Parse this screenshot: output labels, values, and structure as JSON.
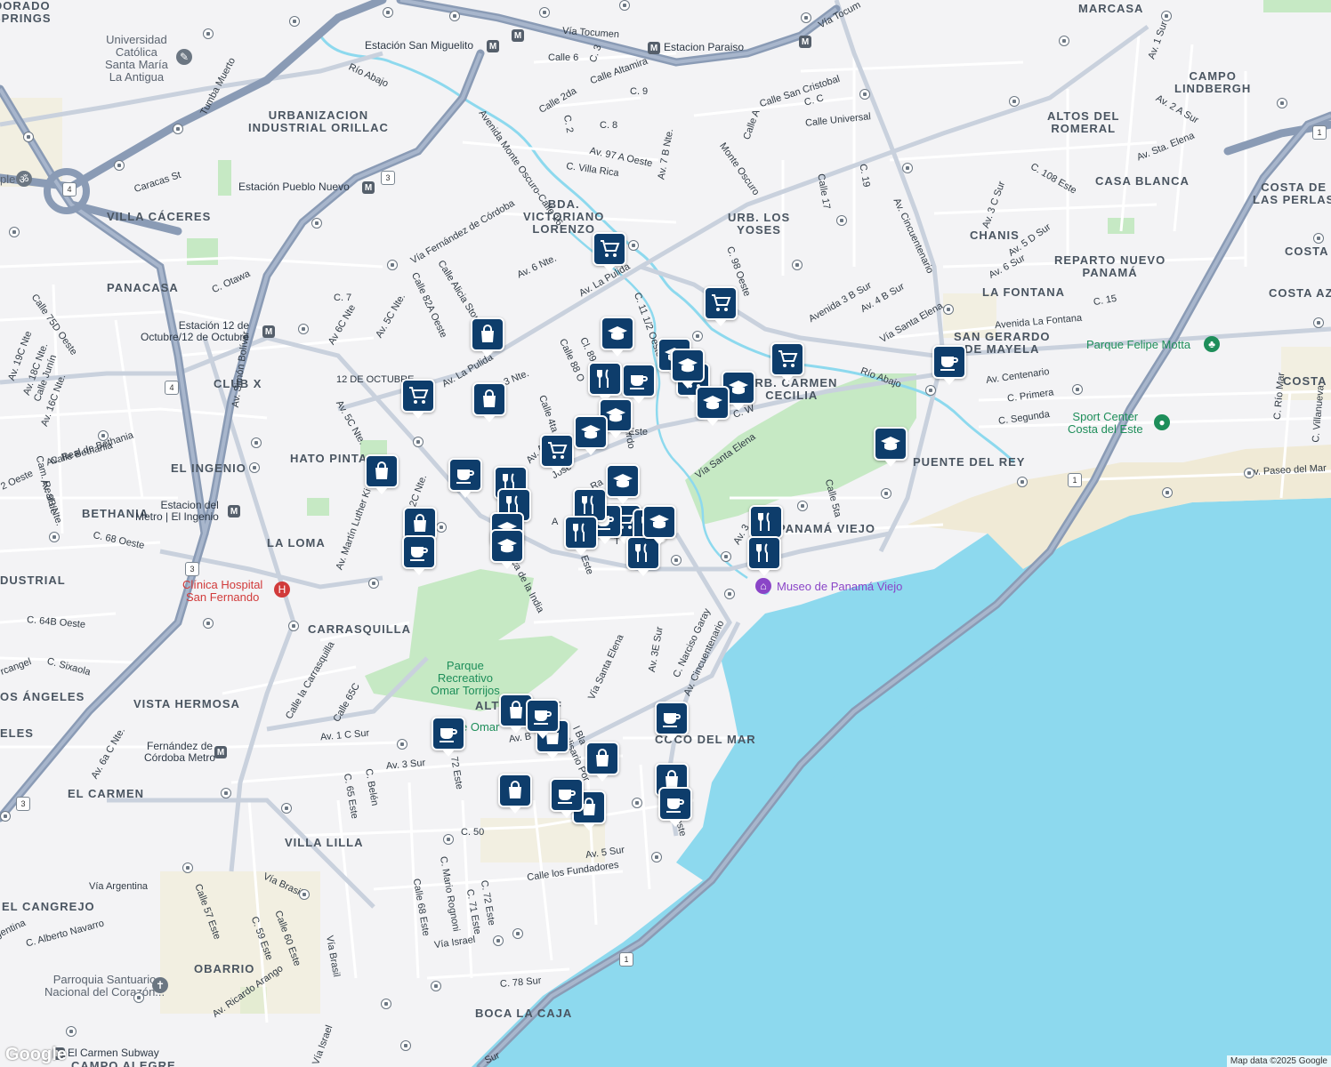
{
  "colors": {
    "water": "#8dd9ee",
    "park": "#c6e9c4",
    "road_major": "#8a9bb5",
    "road_minor": "#ffffff",
    "land": "#f3f3f5",
    "marker": "#0e3d6b",
    "river": "#8dd9ee"
  },
  "areas": [
    {
      "id": "dorado-springs",
      "text": "DORADO\nSPRINGS"
    },
    {
      "id": "marcasa",
      "text": "MARCASA"
    },
    {
      "id": "campo-lindbergh",
      "text": "CAMPO\nLINDBERGH"
    },
    {
      "id": "altos-romeral",
      "text": "ALTOS DEL\nROMERAL"
    },
    {
      "id": "casa-blanca",
      "text": "CASA BLANCA"
    },
    {
      "id": "costa-perlas",
      "text": "COSTA DE\nLAS PERLAS"
    },
    {
      "id": "urb-industrial",
      "text": "URBANIZACION\nINDUSTRIAL ORILLAC"
    },
    {
      "id": "villa-caceres",
      "text": "VILLA CÁCERES"
    },
    {
      "id": "bda-victoriano",
      "text": "BDA.\nVICTORIANO\nLORENZO"
    },
    {
      "id": "urb-yoses",
      "text": "URB. LOS\nYOSES"
    },
    {
      "id": "chanis",
      "text": "CHANIS"
    },
    {
      "id": "reparto-nuevo",
      "text": "REPARTO NUEVO\nPANAMÁ"
    },
    {
      "id": "costa-1",
      "text": "COSTA"
    },
    {
      "id": "costa-az",
      "text": "COSTA AZ"
    },
    {
      "id": "panacasa",
      "text": "PANACASA"
    },
    {
      "id": "la-fontana",
      "text": "LA FONTANA"
    },
    {
      "id": "san-gerardo",
      "text": "SAN GERARDO\nDE MAYELA"
    },
    {
      "id": "club-x",
      "text": "CLUB X"
    },
    {
      "id": "urb-carmen",
      "text": "URB. CARMEN\nCECILIA"
    },
    {
      "id": "costa-2",
      "text": "COSTA"
    },
    {
      "id": "hato-pintado",
      "text": "HATO PINTA"
    },
    {
      "id": "el-ingenio",
      "text": "EL INGENIO"
    },
    {
      "id": "puente-rey",
      "text": "PUENTE DEL REY"
    },
    {
      "id": "bethania",
      "text": "BETHANIA"
    },
    {
      "id": "la-loma",
      "text": "LA LOMA"
    },
    {
      "id": "panama-viejo",
      "text": "PANAMÁ VIEJO"
    },
    {
      "id": "industrial",
      "text": "DUSTRIAL"
    },
    {
      "id": "carrasquilla",
      "text": "CARRASQUILLA"
    },
    {
      "id": "los-angeles",
      "text": "OS ÁNGELES"
    },
    {
      "id": "vista-hermosa",
      "text": "VISTA HERMOSA"
    },
    {
      "id": "altos-golf",
      "text": "ALT         OLF"
    },
    {
      "id": "eles",
      "text": "ELES"
    },
    {
      "id": "coco-mar",
      "text": "COCO DEL MAR"
    },
    {
      "id": "el-carmen",
      "text": "EL CARMEN"
    },
    {
      "id": "villa-lilla",
      "text": "VILLA LILLA"
    },
    {
      "id": "el-cangrejo",
      "text": "EL CANGREJO"
    },
    {
      "id": "obarrio",
      "text": "OBARRIO"
    },
    {
      "id": "boca-caja",
      "text": "BOCA LA CAJA"
    },
    {
      "id": "campo-alegre",
      "text": "CAMPO ALEGRE"
    }
  ],
  "streets": [
    {
      "id": "via-tocumen",
      "text": "Vía Tocumen"
    },
    {
      "id": "via-tocu2",
      "text": "Vía Tocum"
    },
    {
      "id": "calle6",
      "text": "Calle 6"
    },
    {
      "id": "calle-altamira",
      "text": "Calle Altamira"
    },
    {
      "id": "c9",
      "text": "C. 9"
    },
    {
      "id": "calle2da",
      "text": "Calle 2da"
    },
    {
      "id": "c3",
      "text": "C. 3"
    },
    {
      "id": "c8",
      "text": "C. 8"
    },
    {
      "id": "c2",
      "text": "C. 2"
    },
    {
      "id": "av-monte",
      "text": "Avenida Monte Oscuro-Calle 16"
    },
    {
      "id": "av97",
      "text": "Av. 97 A Oeste"
    },
    {
      "id": "villa-rica",
      "text": "C. Villa Rica"
    },
    {
      "id": "av7b",
      "text": "Av. 7 B Nte."
    },
    {
      "id": "monte-oscuro",
      "text": "Monte Oscuro"
    },
    {
      "id": "calle-sc",
      "text": "Calle San Cristobal"
    },
    {
      "id": "cc",
      "text": "C. C"
    },
    {
      "id": "calle-a",
      "text": "Calle A"
    },
    {
      "id": "calle-universal",
      "text": "Calle Universal"
    },
    {
      "id": "calle17",
      "text": "Calle 17"
    },
    {
      "id": "c19",
      "text": "C. 19"
    },
    {
      "id": "av-cinc",
      "text": "Av. Cincuentenario"
    },
    {
      "id": "c108",
      "text": "C. 108 Este"
    },
    {
      "id": "av2asur",
      "text": "Av. 2 A Sur"
    },
    {
      "id": "av-sta-elena",
      "text": "Av. Sta. Elena"
    },
    {
      "id": "av3csur",
      "text": "Av. 3 C Sur"
    },
    {
      "id": "av5dsur",
      "text": "Av. 5 D Sur"
    },
    {
      "id": "av6sur",
      "text": "Av. 6 Sur"
    },
    {
      "id": "av1sur",
      "text": "Av. 1 Sur"
    },
    {
      "id": "tumba",
      "text": "Tumba Muerto"
    },
    {
      "id": "caracas",
      "text": "Caracas St"
    },
    {
      "id": "via-fernandez",
      "text": "Vía Fernández de Córdoba"
    },
    {
      "id": "calle-alicia",
      "text": "Calle Alicia Stone"
    },
    {
      "id": "av6nte",
      "text": "Av. 6 Nte."
    },
    {
      "id": "av-pulida",
      "text": "Av. La Pulida"
    },
    {
      "id": "c98",
      "text": "C. 98 Oeste"
    },
    {
      "id": "av3bsur",
      "text": "Avenida 3 B Sur"
    },
    {
      "id": "av4bsur",
      "text": "Av. 4 B Sur"
    },
    {
      "id": "via-sta-elena",
      "text": "Vía Santa Elena"
    },
    {
      "id": "av-fontana",
      "text": "Avenida La Fontana"
    },
    {
      "id": "c15",
      "text": "C. 15"
    },
    {
      "id": "c-otawa",
      "text": "C. Otawa"
    },
    {
      "id": "c7",
      "text": "C. 7"
    },
    {
      "id": "av6cnte",
      "text": "Av 6C Nte"
    },
    {
      "id": "av5cnte",
      "text": "Av. 5C Nte."
    },
    {
      "id": "calle82a",
      "text": "Calle 82A Oeste"
    },
    {
      "id": "c11",
      "text": "C. 11 1/2 Oeste"
    },
    {
      "id": "av-pulida2",
      "text": "Av. La Pulida"
    },
    {
      "id": "nte3",
      "text": "3 Nte."
    },
    {
      "id": "calle88",
      "text": "Calle 88 O"
    },
    {
      "id": "cl89",
      "text": "Cl. 89"
    },
    {
      "id": "rio-abajo",
      "text": "Río Abajo"
    },
    {
      "id": "rio-abajo2",
      "text": "Río Abajo"
    },
    {
      "id": "av-centenario",
      "text": "Av. Centenario"
    },
    {
      "id": "c-primera",
      "text": "C. Primera"
    },
    {
      "id": "c-segunda",
      "text": "C. Segunda"
    },
    {
      "id": "c-rio-mar",
      "text": "C. Río Mar"
    },
    {
      "id": "c-villanueva",
      "text": "C. Villanueva"
    },
    {
      "id": "av19c",
      "text": "Av. 19C Nte"
    },
    {
      "id": "av18c",
      "text": "Av. 18C Nte."
    },
    {
      "id": "calle-junin",
      "text": "Calle Junín"
    },
    {
      "id": "av16c",
      "text": "Av. 16C Nte."
    },
    {
      "id": "calle75d",
      "text": "Calle 75D Oeste"
    },
    {
      "id": "doce-oct",
      "text": "12 DE OCTUBRE"
    },
    {
      "id": "av5cnte2",
      "text": "Av. 5C Nte."
    },
    {
      "id": "calle4ta",
      "text": "Calle 4ta"
    },
    {
      "id": "cw",
      "text": "C. W"
    },
    {
      "id": "via-sta-elena2",
      "text": "Vía Santa Elena"
    },
    {
      "id": "calle5ta",
      "text": "Calle 5ta"
    },
    {
      "id": "av-paseo",
      "text": "Av. Paseo del Mar"
    },
    {
      "id": "av-bethania",
      "text": "Av. Real de Bethania"
    },
    {
      "id": "oeste2",
      "text": "2 Oeste"
    },
    {
      "id": "av9b",
      "text": "Av. 9B Nte."
    },
    {
      "id": "calle-bethania",
      "text": "Calle Bethania"
    },
    {
      "id": "camino-real",
      "text": "Cam. Real de"
    },
    {
      "id": "av2cnte",
      "text": "Av. 2C Nte."
    },
    {
      "id": "av-mlk",
      "text": "Av. Martín Luther Ki"
    },
    {
      "id": "c68",
      "text": "C. 68 Oeste"
    },
    {
      "id": "av-simon",
      "text": "Av. Simón Bolívar"
    },
    {
      "id": "ave-este",
      "text": "Este"
    },
    {
      "id": "calle-india",
      "text": "lica de la India"
    },
    {
      "id": "c64b",
      "text": "C. 64B Oeste"
    },
    {
      "id": "c-sixaola",
      "text": "C. Sixaola"
    },
    {
      "id": "arcangel",
      "text": "rcangel"
    },
    {
      "id": "calle-carrasquilla",
      "text": "Calle la Carrasquilla"
    },
    {
      "id": "calle65c",
      "text": "Calle 65C"
    },
    {
      "id": "av1csur",
      "text": "Av. 1 C Sur"
    },
    {
      "id": "av3sur",
      "text": "Av. 3 Sur"
    },
    {
      "id": "c72",
      "text": "72 Este"
    },
    {
      "id": "av6acnte",
      "text": "Av. 6a C Nte."
    },
    {
      "id": "c65este",
      "text": "C. 65 Este"
    },
    {
      "id": "c-belen",
      "text": "C. Belén"
    },
    {
      "id": "c50",
      "text": "C. 50"
    },
    {
      "id": "av5sur",
      "text": "Av. 5 Sur"
    },
    {
      "id": "calle-fundadores",
      "text": "Calle los Fundadores"
    },
    {
      "id": "via-argentina",
      "text": "Vía Argentina"
    },
    {
      "id": "via-brasil",
      "text": "Vía Brasil"
    },
    {
      "id": "via-brasil2",
      "text": "Vía Brasil"
    },
    {
      "id": "calle57",
      "text": "Calle 57 Este"
    },
    {
      "id": "c59",
      "text": "C. 59 Este"
    },
    {
      "id": "calle60",
      "text": "Calle 60 Este"
    },
    {
      "id": "c-alberto",
      "text": "C. Alberto Navarro"
    },
    {
      "id": "gentina",
      "text": "gentina"
    },
    {
      "id": "c-mario",
      "text": "C. Mario Rognoni"
    },
    {
      "id": "calle68",
      "text": "Calle 68 Este"
    },
    {
      "id": "c71",
      "text": "C. 71 Este"
    },
    {
      "id": "c72b",
      "text": "C. 72 Este"
    },
    {
      "id": "via-israel",
      "text": "Vía Israel"
    },
    {
      "id": "via-israel2",
      "text": "Vía Israel"
    },
    {
      "id": "c78",
      "text": "C. 78 Sur"
    },
    {
      "id": "av-arango",
      "text": "Av. Ricardo Arango"
    },
    {
      "id": "av3esur",
      "text": "Av. 3E Sur"
    },
    {
      "id": "c-narciso",
      "text": "C. Narciso Garay"
    },
    {
      "id": "av-cinc2",
      "text": "Av. Cincuentenario"
    },
    {
      "id": "via-sta-elena3",
      "text": "Vía Santa Elena"
    },
    {
      "id": "av-bla",
      "text": "Av. B"
    },
    {
      "id": "av-belisario",
      "text": "elisario Por"
    },
    {
      "id": "bla",
      "text": "l Bla"
    },
    {
      "id": "este3",
      "text": "este"
    },
    {
      "id": "sur-bottom",
      "text": "Sur"
    },
    {
      "id": "jose",
      "text": "José"
    },
    {
      "id": "av-a",
      "text": "A"
    },
    {
      "id": "a-t",
      "text": "T"
    },
    {
      "id": "este-c",
      "text": "Este"
    },
    {
      "id": "av3",
      "text": "Av. 3"
    },
    {
      "id": "av-ra",
      "text": "Ra"
    },
    {
      "id": "arango-z",
      "text": "Izquirdo"
    },
    {
      "id": "av-mart",
      "text": "Av. Arna"
    }
  ],
  "pois": [
    {
      "id": "universidad",
      "text": "Universidad\nCatólica\nSanta María\nLa Antigua"
    },
    {
      "id": "parque-felipe",
      "text": "Parque Felipe Motta"
    },
    {
      "id": "sport-center",
      "text": "Sport Center\nCosta del Este"
    },
    {
      "id": "museo",
      "text": "Museo de Panamá Viejo"
    },
    {
      "id": "clinica",
      "text": "Clínica Hospital\nSan Fernando"
    },
    {
      "id": "parque-omar",
      "text": "Parque\nRecreativo\nOmar Torrijos"
    },
    {
      "id": "omar-frag",
      "text": "e Omar"
    },
    {
      "id": "parroquia",
      "text": "Parroquia Santuario\nNacional del Corazón..."
    },
    {
      "id": "ole",
      "text": "ple"
    }
  ],
  "transit": [
    {
      "id": "st-san-miguelito",
      "text": "Estación San Miguelito"
    },
    {
      "id": "st-paraiso",
      "text": "Estacion Paraiso"
    },
    {
      "id": "st-pueblo-nuevo",
      "text": "Estación Pueblo Nuevo"
    },
    {
      "id": "st-12-octubre",
      "text": "Estación 12 de\nOctubre/12 de Octubre"
    },
    {
      "id": "st-el-ingenio",
      "text": "Estacion del\nMetro | El Ingenio"
    },
    {
      "id": "st-fernandez",
      "text": "Fernández de\nCórdoba Metro"
    },
    {
      "id": "st-el-carmen",
      "text": "El Carmen Subway"
    }
  ],
  "route_shields": [
    "4",
    "4",
    "3",
    "3",
    "3",
    "1",
    "1",
    "1",
    "1",
    "4"
  ],
  "credit": "Map data ©2025 Google",
  "logo": "Google"
}
